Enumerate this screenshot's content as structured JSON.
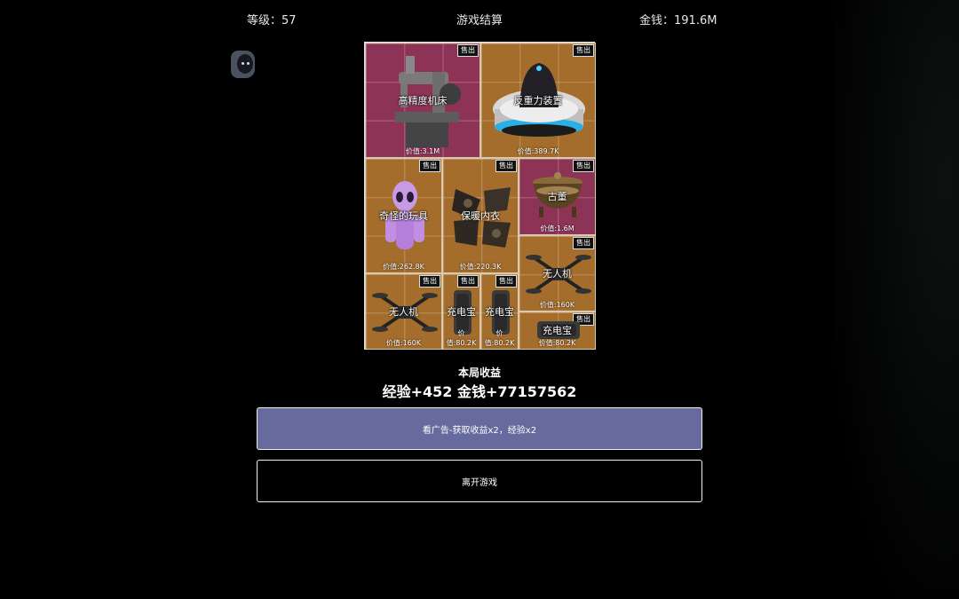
{
  "header": {
    "level_label": "等级：57",
    "title": "游戏结算",
    "money_label": "金钱：191.6M"
  },
  "items": [
    {
      "name": "高精度机床",
      "price": "价值:3.1M",
      "sell": "售出",
      "icon": "sewing-machine-icon",
      "bg": "#8d3456"
    },
    {
      "name": "反重力装置",
      "price": "价值:389.7K",
      "sell": "售出",
      "icon": "antigravity-device-icon",
      "bg": "#a46d2b"
    },
    {
      "name": "奇怪的玩具",
      "price": "价值:262.8K",
      "sell": "售出",
      "icon": "alien-toy-icon",
      "bg": "#a46d2b"
    },
    {
      "name": "保暖内衣",
      "price": "价值:220.3K",
      "sell": "售出",
      "icon": "thermal-underwear-icon",
      "bg": "#a46d2b"
    },
    {
      "name": "古董",
      "price": "价值:1.6M",
      "sell": "售出",
      "icon": "incense-burner-icon",
      "bg": "#8d3456"
    },
    {
      "name": "无人机",
      "price": "价值:160K",
      "sell": "售出",
      "icon": "drone-icon",
      "bg": "#a46d2b"
    },
    {
      "name": "无人机",
      "price": "价值:160K",
      "sell": "售出",
      "icon": "drone-icon",
      "bg": "#a46d2b"
    },
    {
      "name": "充电宝",
      "price": "价值:80.2K",
      "sell": "售出",
      "icon": "power-bank-icon",
      "bg": "#a46d2b"
    },
    {
      "name": "充电宝",
      "price": "价值:80.2K",
      "sell": "售出",
      "icon": "power-bank-icon",
      "bg": "#a46d2b"
    },
    {
      "name": "充电宝",
      "price": "价值:80.2K",
      "sell": "售出",
      "icon": "power-bank-icon",
      "bg": "#a46d2b"
    }
  ],
  "summary": {
    "title": "本局收益",
    "rewards": "经验+452 金钱+77157562"
  },
  "buttons": {
    "ad_label": "看广告-获取收益x2，经验x2",
    "leave_label": "离开游戏"
  }
}
